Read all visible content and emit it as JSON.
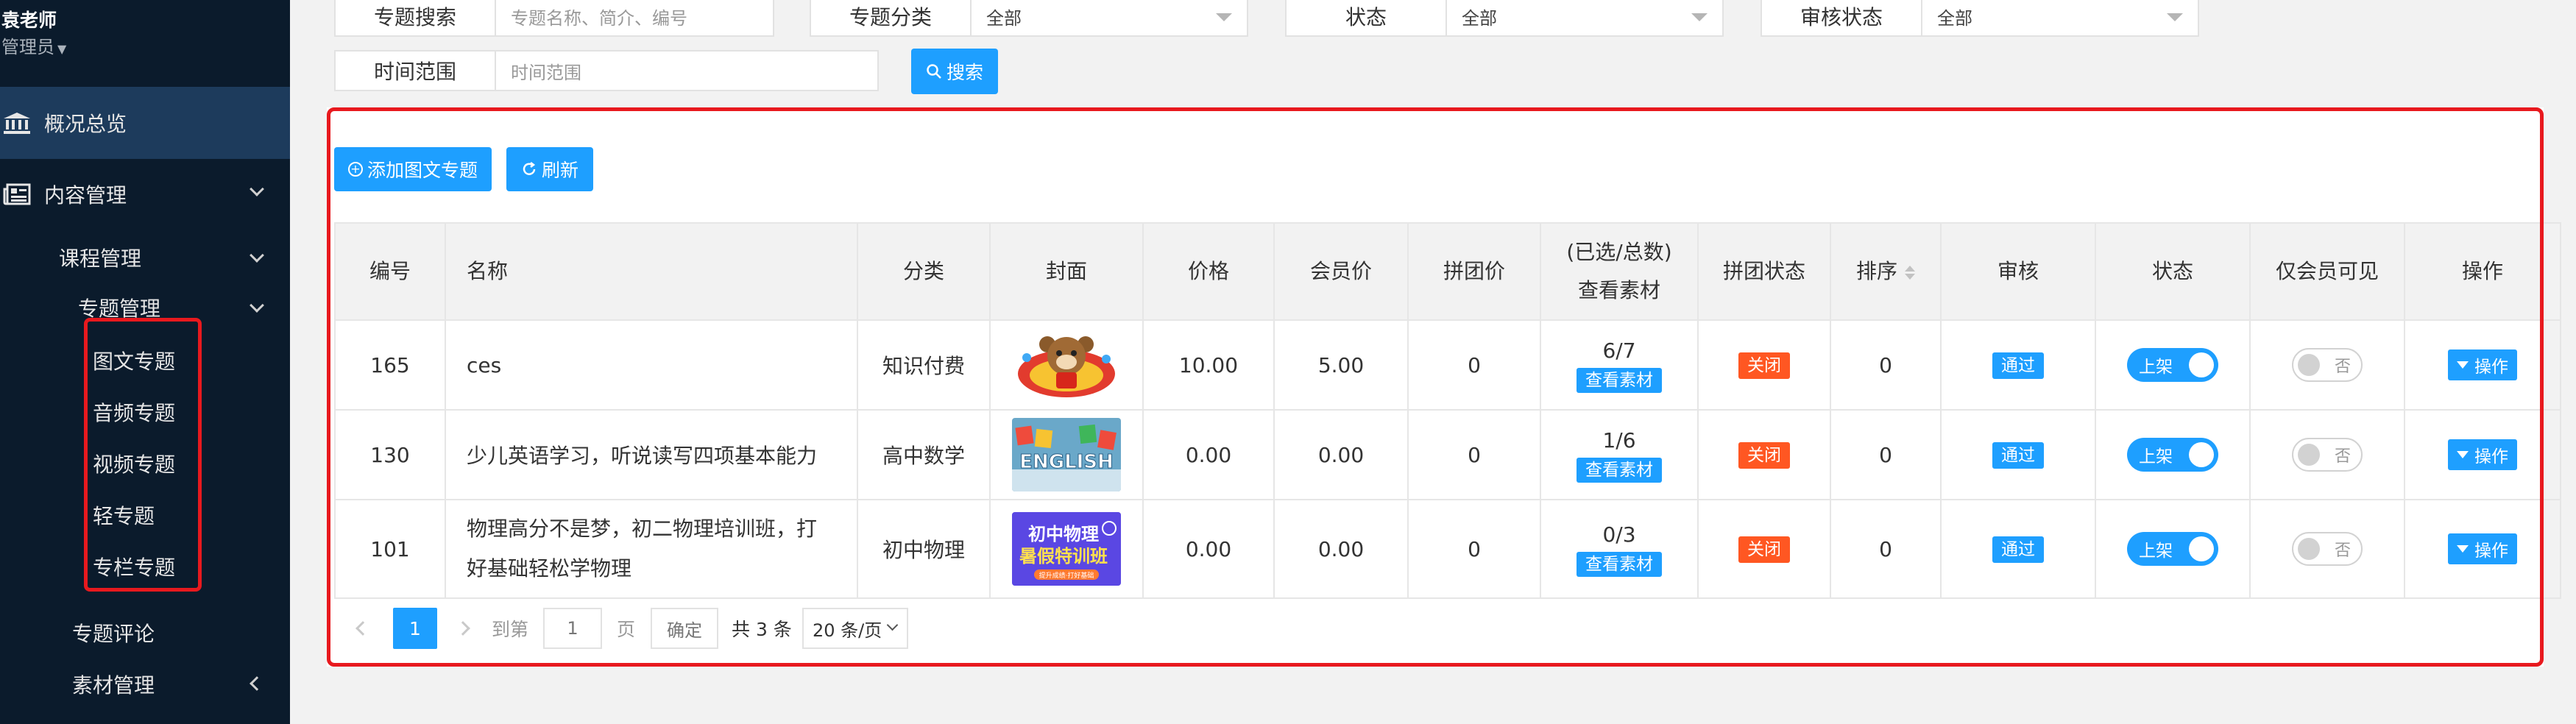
{
  "user": {
    "name": "袁老师",
    "role": "管理员"
  },
  "nav": {
    "overview": "概况总览",
    "content": "内容管理",
    "course": "课程管理",
    "topic": "专题管理",
    "topic_items": [
      "图文专题",
      "音频专题",
      "视频专题",
      "轻专题",
      "专栏专题"
    ],
    "comments": "专题评论",
    "materials": "素材管理"
  },
  "filters": {
    "search_label": "专题搜索",
    "search_placeholder": "专题名称、简介、编号",
    "category_label": "专题分类",
    "category_value": "全部",
    "status_label": "状态",
    "status_value": "全部",
    "review_label": "审核状态",
    "review_value": "全部",
    "time_label": "时间范围",
    "time_placeholder": "时间范围",
    "search_button": "搜索"
  },
  "toolbar": {
    "add_button": "添加图文专题",
    "refresh_button": "刷新"
  },
  "table": {
    "headers": {
      "id": "编号",
      "name": "名称",
      "category": "分类",
      "cover": "封面",
      "price": "价格",
      "member_price": "会员价",
      "group_price": "拼团价",
      "materials_line1": "(已选/总数)",
      "materials_line2": "查看素材",
      "group_status": "拼团状态",
      "sort": "排序",
      "review": "审核",
      "status": "状态",
      "member_only": "仅会员可见",
      "action": "操作"
    },
    "rows": [
      {
        "id": "165",
        "name": "ces",
        "category": "知识付费",
        "price": "10.00",
        "member_price": "5.00",
        "group_price": "0",
        "materials": "6/7",
        "view_materials": "查看素材",
        "group_status": "关闭",
        "sort": "0",
        "review": "通过",
        "status": "上架",
        "member_only": "否",
        "action": "操作"
      },
      {
        "id": "130",
        "name": "少儿英语学习，听说读写四项基本能力",
        "category": "高中数学",
        "price": "0.00",
        "member_price": "0.00",
        "group_price": "0",
        "materials": "1/6",
        "view_materials": "查看素材",
        "group_status": "关闭",
        "sort": "0",
        "review": "通过",
        "status": "上架",
        "member_only": "否",
        "action": "操作"
      },
      {
        "id": "101",
        "name_line1": "物理高分不是梦，初二物理培训班，打",
        "name_line2": "好基础轻松学物理",
        "category": "初中物理",
        "price": "0.00",
        "member_price": "0.00",
        "group_price": "0",
        "materials": "0/3",
        "view_materials": "查看素材",
        "group_status": "关闭",
        "sort": "0",
        "review": "通过",
        "status": "上架",
        "member_only": "否",
        "action": "操作"
      }
    ],
    "cover_texts": {
      "english": "ENGLISH",
      "physics_title": "初中物理",
      "physics_sub": "暑假特训班",
      "physics_tag": "提升成绩·打好基础"
    }
  },
  "pagination": {
    "current": "1",
    "goto_label": "到第",
    "page_input": "1",
    "page_unit": "页",
    "confirm": "确定",
    "total": "共 3 条",
    "page_size": "20 条/页"
  },
  "colors": {
    "sidebar_bg": "#0b1b2c",
    "sidebar_active": "#1d3b5c",
    "primary": "#1e9fff",
    "danger": "#ff5722",
    "highlight": "#e8191e"
  }
}
